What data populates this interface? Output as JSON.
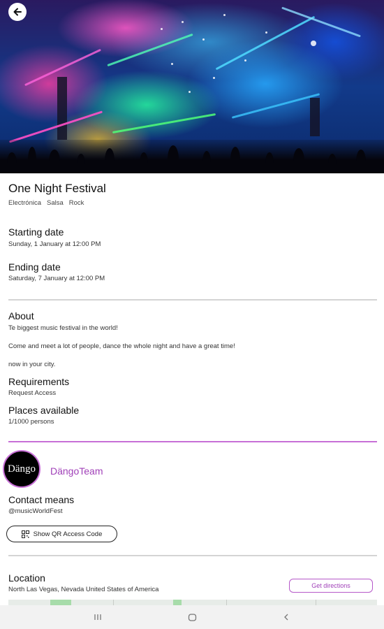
{
  "event": {
    "title": "One Night Festival",
    "tags": [
      "Electrónica",
      "Salsa",
      "Rock"
    ]
  },
  "starting": {
    "heading": "Starting date",
    "value": "Sunday, 1 January at 12:00 PM"
  },
  "ending": {
    "heading": "Ending date",
    "value": "Saturday, 7 January at 12:00 PM"
  },
  "about": {
    "heading": "About",
    "lines": [
      "Te biggest music festival in the world!",
      "Come and meet a lot of people, dance the whole night and have a great time!",
      "now in your city."
    ]
  },
  "requirements": {
    "heading": "Requirements",
    "value": "Request Access"
  },
  "places": {
    "heading": "Places available",
    "value": "1/1000 persons"
  },
  "organizer": {
    "avatar_text": "Dängo",
    "name": "DängoTeam"
  },
  "contact": {
    "heading": "Contact means",
    "value": "@musicWorldFest",
    "qr_label": "Show QR Access Code"
  },
  "location": {
    "heading": "Location",
    "address": "North Las Vegas, Nevada United States of America",
    "directions_label": "Get directions"
  },
  "icons": {
    "back": "arrow-left-icon",
    "qr": "qr-code-icon",
    "nav_recent": "recent-apps-icon",
    "nav_home": "home-icon",
    "nav_back": "chevron-left-icon"
  },
  "colors": {
    "accent": "#c76fd6",
    "accent_text": "#a040b8",
    "divider": "#d4d4d4"
  }
}
